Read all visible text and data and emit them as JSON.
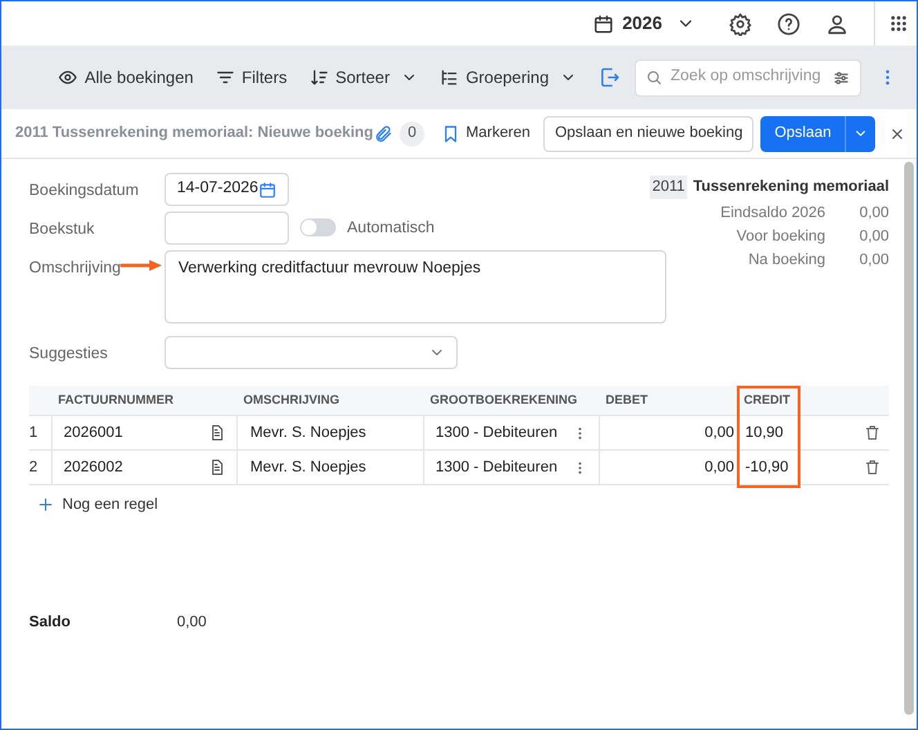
{
  "top_bar": {
    "year": "2026"
  },
  "toolbar": {
    "items": [
      {
        "kind": "view",
        "label": "Alle boekingen",
        "dropdown": false
      },
      {
        "kind": "filter",
        "label": "Filters",
        "dropdown": false
      },
      {
        "kind": "sort",
        "label": "Sorteer",
        "dropdown": true
      },
      {
        "kind": "group",
        "label": "Groepering",
        "dropdown": true
      }
    ],
    "search": {
      "placeholder": "Zoek op omschrijving"
    }
  },
  "header": {
    "title": "2011 Tussenrekening memoriaal: Nieuwe boeking",
    "attachments": "0",
    "mark_label": "Markeren",
    "save_new_label": "Opslaan en nieuwe boeking",
    "save_label": "Opslaan"
  },
  "form": {
    "date": {
      "label": "Boekingsdatum",
      "value": "14-07-2026"
    },
    "document": {
      "label": "Boekstuk",
      "toggle_label": "Automatisch",
      "automatic": false
    },
    "description": {
      "label": "Omschrijving",
      "value": "Verwerking creditfactuur mevrouw Noepjes",
      "arrow": true
    },
    "suggestions": {
      "label": "Suggesties"
    }
  },
  "account_summary": {
    "code": "2011",
    "name": "Tussenrekening memoriaal",
    "rows": [
      {
        "label": "Eindsaldo 2026",
        "value": "0,00"
      },
      {
        "label": "Voor boeking",
        "value": "0,00"
      },
      {
        "label": "Na boeking",
        "value": "0,00"
      }
    ]
  },
  "table": {
    "columns": [
      {
        "label": "FACTUURNUMMER",
        "highlighted": false
      },
      {
        "label": "OMSCHRIJVING",
        "highlighted": false
      },
      {
        "label": "GROOTBOEKREKENING",
        "highlighted": false
      },
      {
        "label": "DEBET",
        "highlighted": false
      },
      {
        "label": "CREDIT",
        "highlighted": true
      }
    ],
    "rows": [
      {
        "number": "1",
        "invoice": "2026001",
        "description": "Mevr. S. Noepjes",
        "account": "1300 - Debiteuren",
        "debit": "0,00",
        "credit": "10,90"
      },
      {
        "number": "2",
        "invoice": "2026002",
        "description": "Mevr. S. Noepjes",
        "account": "1300 - Debiteuren",
        "debit": "0,00",
        "credit": "-10,90"
      }
    ],
    "add_row_label": "Nog een regel"
  },
  "saldo": {
    "label": "Saldo",
    "value": "0,00"
  }
}
